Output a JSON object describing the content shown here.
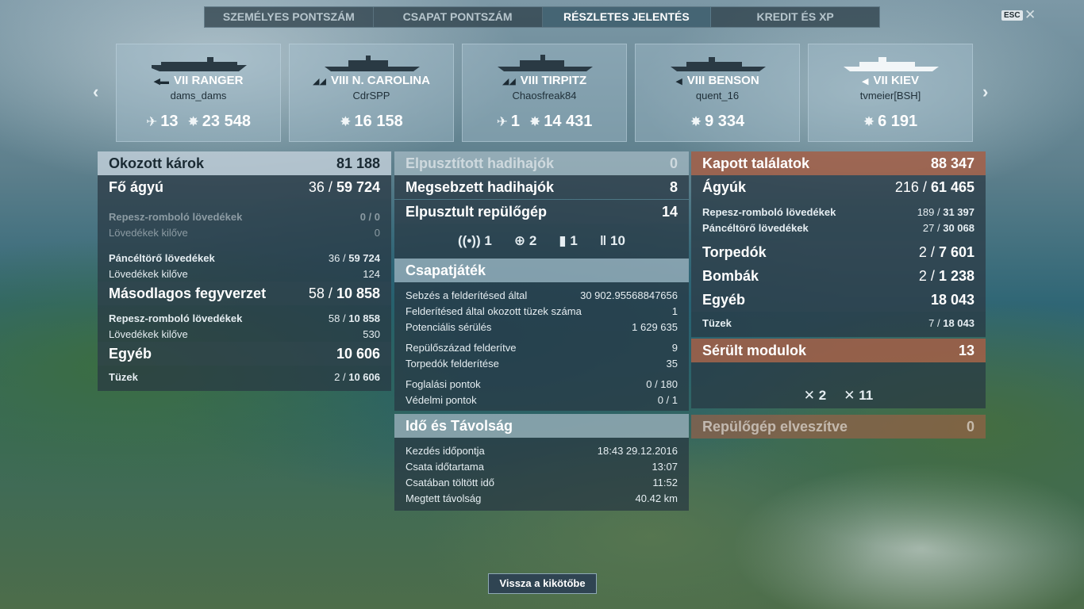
{
  "tabs": [
    "Személyes pontszám",
    "Csapat pontszám",
    "Részletes jelentés",
    "Kredit és XP"
  ],
  "active_tab": 2,
  "esc_label": "ESC",
  "close_symbol": "✕",
  "nav": {
    "prev": "‹",
    "next": "›"
  },
  "ships": [
    {
      "tier_name": "VII RANGER",
      "player": "dams_dams",
      "stat1": "13",
      "stat2": "23 548",
      "class_icon": "carrier-icon"
    },
    {
      "tier_name": "VIII N. CAROLINA",
      "player": "CdrSPP",
      "stat1": "",
      "stat2": "16 158",
      "class_icon": "battleship-icon"
    },
    {
      "tier_name": "VIII TIRPITZ",
      "player": "Chaosfreak84",
      "stat1": "1",
      "stat2": "14 431",
      "class_icon": "battleship-icon"
    },
    {
      "tier_name": "VIII BENSON",
      "player": "quent_16",
      "stat1": "",
      "stat2": "9 334",
      "class_icon": "destroyer-icon"
    },
    {
      "tier_name": "VII KIEV",
      "player": "tvmeier[BSH]",
      "stat1": "",
      "stat2": "6 191",
      "class_icon": "destroyer-icon"
    }
  ],
  "left": {
    "damage": {
      "label": "Okozott károk",
      "value": "81 188"
    },
    "main": {
      "label": "Fő ágyú",
      "a": "36 /",
      "b": "59 724"
    },
    "he1": {
      "label": "Repesz-romboló lövedékek",
      "value": "0 / 0"
    },
    "shots1": {
      "label": "Lövedékek kilőve",
      "value": "0"
    },
    "ap": {
      "label": "Páncéltörő lövedékek",
      "a": "36 /",
      "b": "59 724"
    },
    "shots2": {
      "label": "Lövedékek kilőve",
      "value": "124"
    },
    "secondary": {
      "label": "Másodlagos fegyverzet",
      "a": "58 /",
      "b": "10 858"
    },
    "he2": {
      "label": "Repesz-romboló lövedékek",
      "a": "58 /",
      "b": "10 858"
    },
    "shots3": {
      "label": "Lövedékek kilőve",
      "value": "530"
    },
    "other": {
      "label": "Egyéb",
      "value": "10 606"
    },
    "fires": {
      "label": "Tüzek",
      "a": "2 /",
      "b": "10 606"
    }
  },
  "middle": {
    "destroyed": {
      "label": "Elpusztított hadihajók",
      "value": "0"
    },
    "damaged": {
      "label": "Megsebzett hadihajók",
      "value": "8"
    },
    "planes": {
      "label": "Elpusztult repülőgép",
      "value": "14"
    },
    "icons": [
      {
        "icon": "radar-icon",
        "value": "1"
      },
      {
        "icon": "crosshair-icon",
        "value": "2"
      },
      {
        "icon": "bomb-icon",
        "value": "1"
      },
      {
        "icon": "shells-icon",
        "value": "10"
      }
    ],
    "team_title": "Csapatjáték",
    "team": [
      {
        "label": "Sebzés a felderítésed által",
        "value": "30 902.95568847656"
      },
      {
        "label": "Felderítésed által okozott tüzek száma",
        "value": "1"
      },
      {
        "label": "Potenciális sérülés",
        "value": "1 629 635"
      },
      {
        "label": "Repülőszázad felderítve",
        "value": "9"
      },
      {
        "label": "Torpedók felderítése",
        "value": "35"
      },
      {
        "label": "Foglalási pontok",
        "value": "0 / 180"
      },
      {
        "label": "Védelmi pontok",
        "value": "0 / 1"
      }
    ],
    "time_title": "Idő és Távolság",
    "time": [
      {
        "label": "Kezdés időpontja",
        "value": "18:43  29.12.2016"
      },
      {
        "label": "Csata időtartama",
        "value": "13:07"
      },
      {
        "label": "Csatában töltött idő",
        "value": "11:52"
      },
      {
        "label": "Megtett távolság",
        "value": "40.42 km"
      }
    ]
  },
  "right": {
    "hits": {
      "label": "Kapott találatok",
      "value": "88 347"
    },
    "guns": {
      "label": "Ágyúk",
      "a": "216 /",
      "b": "61 465"
    },
    "he": {
      "label": "Repesz-romboló lövedékek",
      "a": "189 /",
      "b": "31 397"
    },
    "ap": {
      "label": "Páncéltörő lövedékek",
      "a": "27 /",
      "b": "30 068"
    },
    "torp": {
      "label": "Torpedók",
      "a": "2 /",
      "b": "7 601"
    },
    "bombs": {
      "label": "Bombák",
      "a": "2 /",
      "b": "1 238"
    },
    "other": {
      "label": "Egyéb",
      "value": "18 043"
    },
    "fires": {
      "label": "Tüzek",
      "a": "7 /",
      "b": "18 043"
    },
    "modules": {
      "label": "Sérült modulok",
      "value": "13"
    },
    "module_icons": [
      {
        "icon": "gun-module-icon",
        "value": "2"
      },
      {
        "icon": "steering-module-icon",
        "value": "11"
      }
    ],
    "lost_planes": {
      "label": "Repülőgép elveszítve",
      "value": "0"
    }
  },
  "back_button": "Vissza a kikötőbe"
}
